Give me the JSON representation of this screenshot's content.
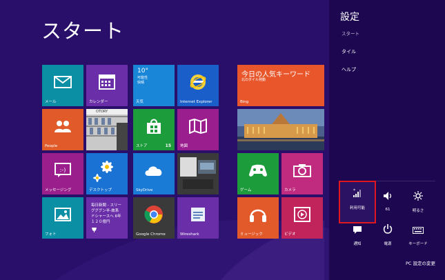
{
  "start": {
    "title": "スタート"
  },
  "tiles": {
    "mail": {
      "label": "メール"
    },
    "calendar": {
      "label": "カレンダー"
    },
    "weather": {
      "temp": "10°",
      "desc1": "可能性",
      "desc2": "快晴",
      "label": "天気"
    },
    "ie": {
      "label": "Internet Explorer"
    },
    "bing": {
      "headline": "今日の人気キーワード",
      "sub": "北のダイル発動",
      "label": "Bing"
    },
    "people": {
      "label": "People"
    },
    "photos": {
      "store_text": "OTORY"
    },
    "store": {
      "label": "ストア",
      "badge": "15"
    },
    "maps": {
      "label": "地図"
    },
    "messaging": {
      "label": "メッセージング"
    },
    "desktop": {
      "label": "デスクトップ"
    },
    "skydrive": {
      "label": "SkyDrive"
    },
    "games": {
      "label": "ゲーム"
    },
    "camera": {
      "label": "カメラ"
    },
    "photo": {
      "label": "フォト"
    },
    "sports": {
      "line1": "毎日新聞 - スリー",
      "line2": "グググン半-故系",
      "line3": "ドシャースへ 6年",
      "line4": "１２０億円"
    },
    "chrome": {
      "label": "Google Chrome"
    },
    "wireshark": {
      "label": "Wireshark"
    },
    "music": {
      "label": "ミュージック"
    },
    "video": {
      "label": "ビデオ"
    }
  },
  "charms": {
    "heading": "設定",
    "sub": "スタート",
    "links": [
      "タイル",
      "ヘルプ"
    ],
    "quick": {
      "network": "利用可能",
      "volume": "61",
      "brightness": "明るさ",
      "notifications": "通知",
      "power": "電源",
      "keyboard": "キーボード"
    },
    "pc_settings": "PC 設定の変更"
  },
  "colors": {
    "background": "#2a0f6a",
    "charms": "#1c0750",
    "highlight": "#e0171f"
  }
}
